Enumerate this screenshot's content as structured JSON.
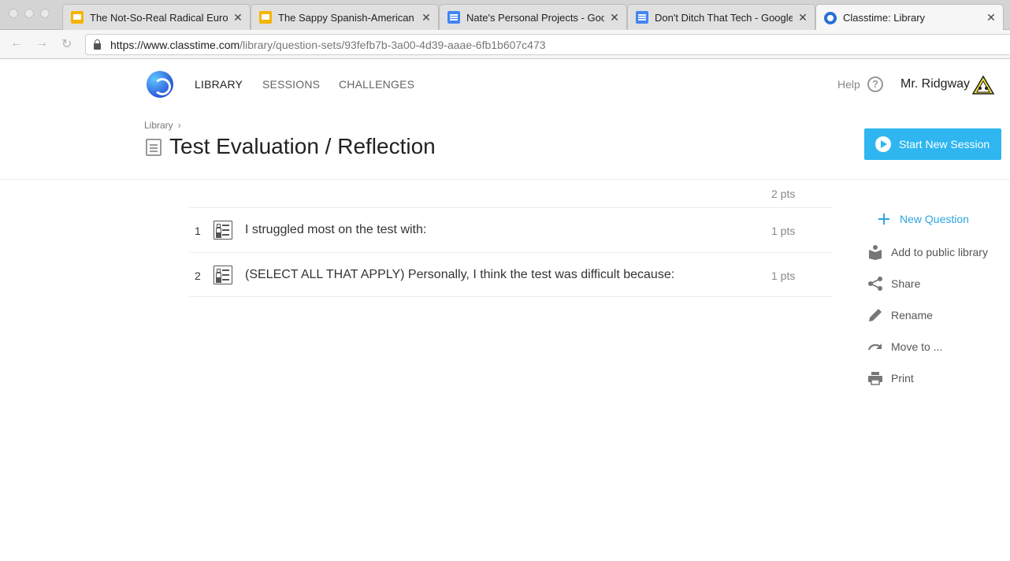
{
  "browser": {
    "tabs": [
      {
        "title": "The Not-So-Real Radical Europ",
        "icon": "slides-icon"
      },
      {
        "title": "The Sappy Spanish-American",
        "icon": "slides-icon"
      },
      {
        "title": "Nate's Personal Projects - Goo",
        "icon": "docs-icon"
      },
      {
        "title": "Don't Ditch That Tech - Google",
        "icon": "docs-icon"
      },
      {
        "title": "Classtime: Library",
        "icon": "classtime-icon"
      }
    ],
    "url_host": "https://www.classtime.com",
    "url_path": "/library/question-sets/93fefb7b-3a00-4d39-aaae-6fb1b607c473"
  },
  "nav": {
    "library": "LIBRARY",
    "sessions": "SESSIONS",
    "challenges": "CHALLENGES",
    "help": "Help",
    "user": "Mr. Ridgway"
  },
  "header": {
    "breadcrumb": "Library",
    "title": "Test Evaluation / Reflection",
    "start_button": "Start New Session"
  },
  "questions": {
    "total_points": "2 pts",
    "items": [
      {
        "number": "1",
        "text": "I struggled most on the test with:",
        "points": "1 pts"
      },
      {
        "number": "2",
        "text": "(SELECT ALL THAT APPLY) Personally, I think the test was difficult because:",
        "points": "1 pts"
      }
    ]
  },
  "sidebar": {
    "new_question": "New Question",
    "add_public": "Add to public library",
    "share": "Share",
    "rename": "Rename",
    "move": "Move to ...",
    "print": "Print"
  },
  "colors": {
    "accent": "#2fb6f0",
    "link": "#2ea5e0"
  }
}
